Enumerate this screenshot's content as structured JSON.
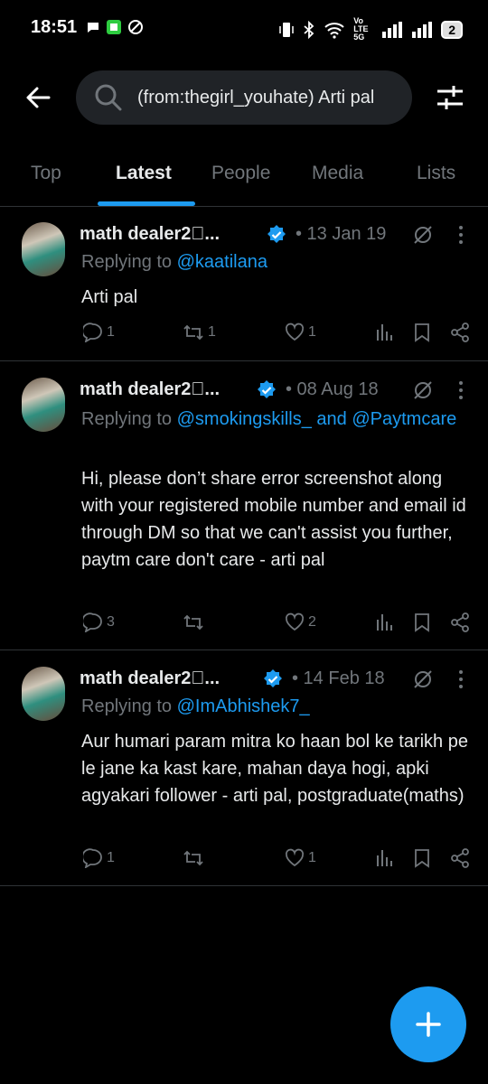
{
  "status_bar": {
    "time": "18:51",
    "network": "Vo LTE 5G",
    "battery": "2"
  },
  "search": {
    "value": "(from:thegirl_youhate) Arti pal",
    "placeholder": "Search"
  },
  "tabs": [
    "Top",
    "Latest",
    "People",
    "Media",
    "Lists"
  ],
  "active_tab": "Latest",
  "colors": {
    "accent": "#1d9bf0",
    "background": "#000000",
    "muted": "#71767b"
  },
  "tweets": [
    {
      "name": "math dealer2⃣...",
      "date": "• 13 Jan 19",
      "replying_prefix": "Replying to",
      "replying_to": "@kaatilana",
      "body": "Arti pal",
      "reply_count": "1",
      "retweet_count": "1",
      "like_count": "1"
    },
    {
      "name": "math dealer2⃣...",
      "date": "• 08 Aug 18",
      "replying_prefix": "Replying to",
      "replying_to": "@smokingskills_ and @Paytmcare",
      "body": "Hi, please don’t share error screenshot along with your registered mobile number and email id through DM so that we can't assist you further, paytm care don't care - arti pal",
      "reply_count": "3",
      "retweet_count": "",
      "like_count": "2"
    },
    {
      "name": "math dealer2⃣...",
      "date": "• 14 Feb 18",
      "replying_prefix": "Replying to",
      "replying_to": "@ImAbhishek7_",
      "body": "Aur humari param mitra ko haan bol ke tarikh pe le jane ka kast kare, mahan daya hogi, apki agyakari follower - arti pal, postgraduate(maths)",
      "reply_count": "1",
      "retweet_count": "",
      "like_count": "1"
    }
  ]
}
